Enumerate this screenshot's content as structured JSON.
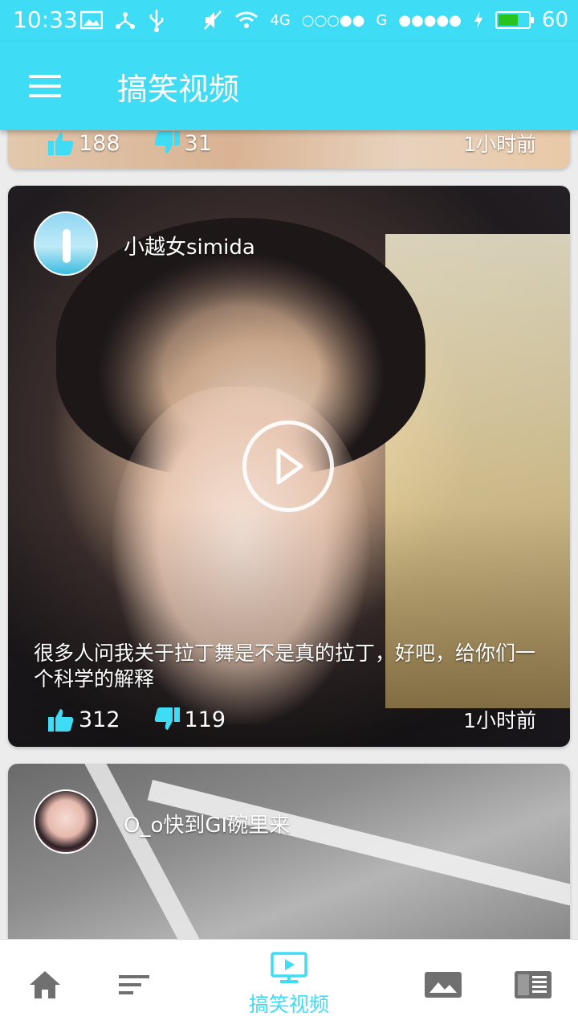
{
  "status_bar": {
    "time": "10:33",
    "network_4g": "4G",
    "network_g": "G",
    "battery_level": "60"
  },
  "app_bar": {
    "title": "搞笑视频"
  },
  "feed": [
    {
      "likes": "188",
      "dislikes": "31",
      "time": "1小时前"
    },
    {
      "username": "小越女simida",
      "description": "很多人问我关于拉丁舞是不是真的拉丁，好吧，给你们一个科学的解释",
      "likes": "312",
      "dislikes": "119",
      "time": "1小时前"
    },
    {
      "username": "O_o快到GI碗里来"
    }
  ],
  "bottom_nav": {
    "active_label": "搞笑视频"
  },
  "colors": {
    "accent": "#3fdcf5",
    "thumb_up": "#3fdcf5",
    "thumb_down": "#3fdcf5"
  }
}
